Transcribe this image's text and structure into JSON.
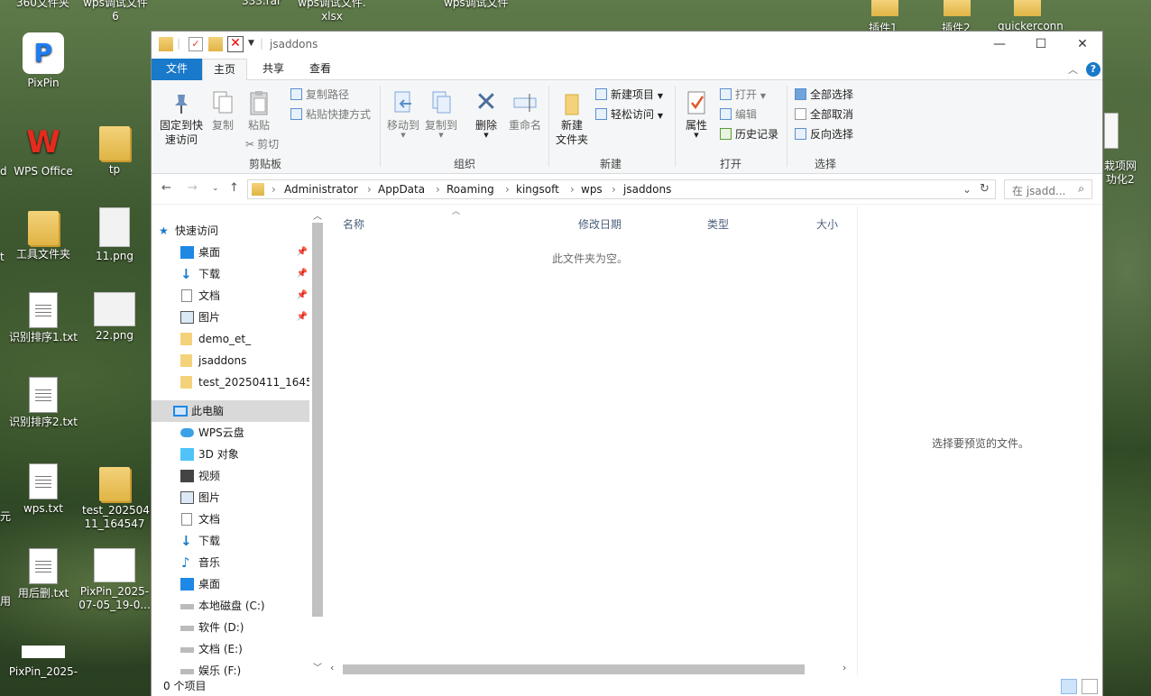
{
  "desktop": {
    "top_fragments": [
      "360文件夹",
      "wps调试文件\n6",
      "333.rar",
      "wps调试文件.\nxlsx",
      "wps调试文件",
      "插件1",
      "插件2",
      "quickerconn"
    ],
    "icons": [
      {
        "label": "PixPin",
        "kind": "pixpin"
      },
      {
        "label": "WPS Office",
        "kind": "wps"
      },
      {
        "label": "tp",
        "kind": "folder"
      },
      {
        "label": "工具文件夹",
        "kind": "folder"
      },
      {
        "label": "11.png",
        "kind": "image"
      },
      {
        "label": "识别排序1.txt",
        "kind": "text"
      },
      {
        "label": "22.png",
        "kind": "image"
      },
      {
        "label": "识别排序2.txt",
        "kind": "text"
      },
      {
        "label": "wps.txt",
        "kind": "text"
      },
      {
        "label": "test_202504\n11_164547",
        "kind": "folder"
      },
      {
        "label": "用后删.txt",
        "kind": "text"
      },
      {
        "label": "PixPin_2025-\n07-05_19-0...",
        "kind": "image"
      },
      {
        "label": "PixPin_2025-",
        "kind": "image"
      }
    ],
    "left_edge_fragments": [
      "d",
      "t",
      "元",
      "用"
    ],
    "right_fragments": [
      "栽项网",
      "功化2"
    ]
  },
  "window": {
    "title": "jsaddons",
    "controls": {
      "minimize": "—",
      "maximize": "☐",
      "close": "✕"
    },
    "tabs": {
      "file": "文件",
      "home": "主页",
      "share": "共享",
      "view": "查看"
    },
    "ribbon": {
      "pin": "固定到快\n速访问",
      "copy": "复制",
      "paste": "粘贴",
      "copy_path": "复制路径",
      "paste_shortcut": "粘贴快捷方式",
      "cut": "剪切",
      "move_to": "移动到",
      "copy_to": "复制到",
      "delete": "删除",
      "rename": "重命名",
      "new_folder": "新建\n文件夹",
      "new_item": "新建项目",
      "easy_access": "轻松访问",
      "properties": "属性",
      "open": "打开",
      "edit": "编辑",
      "history": "历史记录",
      "select_all": "全部选择",
      "select_none": "全部取消",
      "invert": "反向选择",
      "groups": {
        "clipboard": "剪贴板",
        "organize": "组织",
        "new": "新建",
        "open": "打开",
        "select": "选择"
      }
    },
    "address": {
      "crumbs": [
        "Administrator",
        "AppData",
        "Roaming",
        "kingsoft",
        "wps",
        "jsaddons"
      ],
      "search_placeholder": "在 jsadd..."
    },
    "nav": {
      "quick_access": "快速访问",
      "quick_items": [
        {
          "label": "桌面",
          "pinned": true
        },
        {
          "label": "下载",
          "pinned": true
        },
        {
          "label": "文档",
          "pinned": true
        },
        {
          "label": "图片",
          "pinned": true
        },
        {
          "label": "demo_et_",
          "pinned": false
        },
        {
          "label": "jsaddons",
          "pinned": false
        },
        {
          "label": "test_20250411_16454",
          "pinned": false
        }
      ],
      "this_pc": "此电脑",
      "pc_items": [
        "WPS云盘",
        "3D 对象",
        "视频",
        "图片",
        "文档",
        "下载",
        "音乐",
        "桌面",
        "本地磁盘 (C:)",
        "软件 (D:)",
        "文档 (E:)",
        "娱乐 (F:)"
      ]
    },
    "columns": {
      "name": "名称",
      "modified": "修改日期",
      "type": "类型",
      "size": "大小"
    },
    "empty_text": "此文件夹为空。",
    "preview_text": "选择要预览的文件。",
    "status_text": "0 个项目"
  }
}
